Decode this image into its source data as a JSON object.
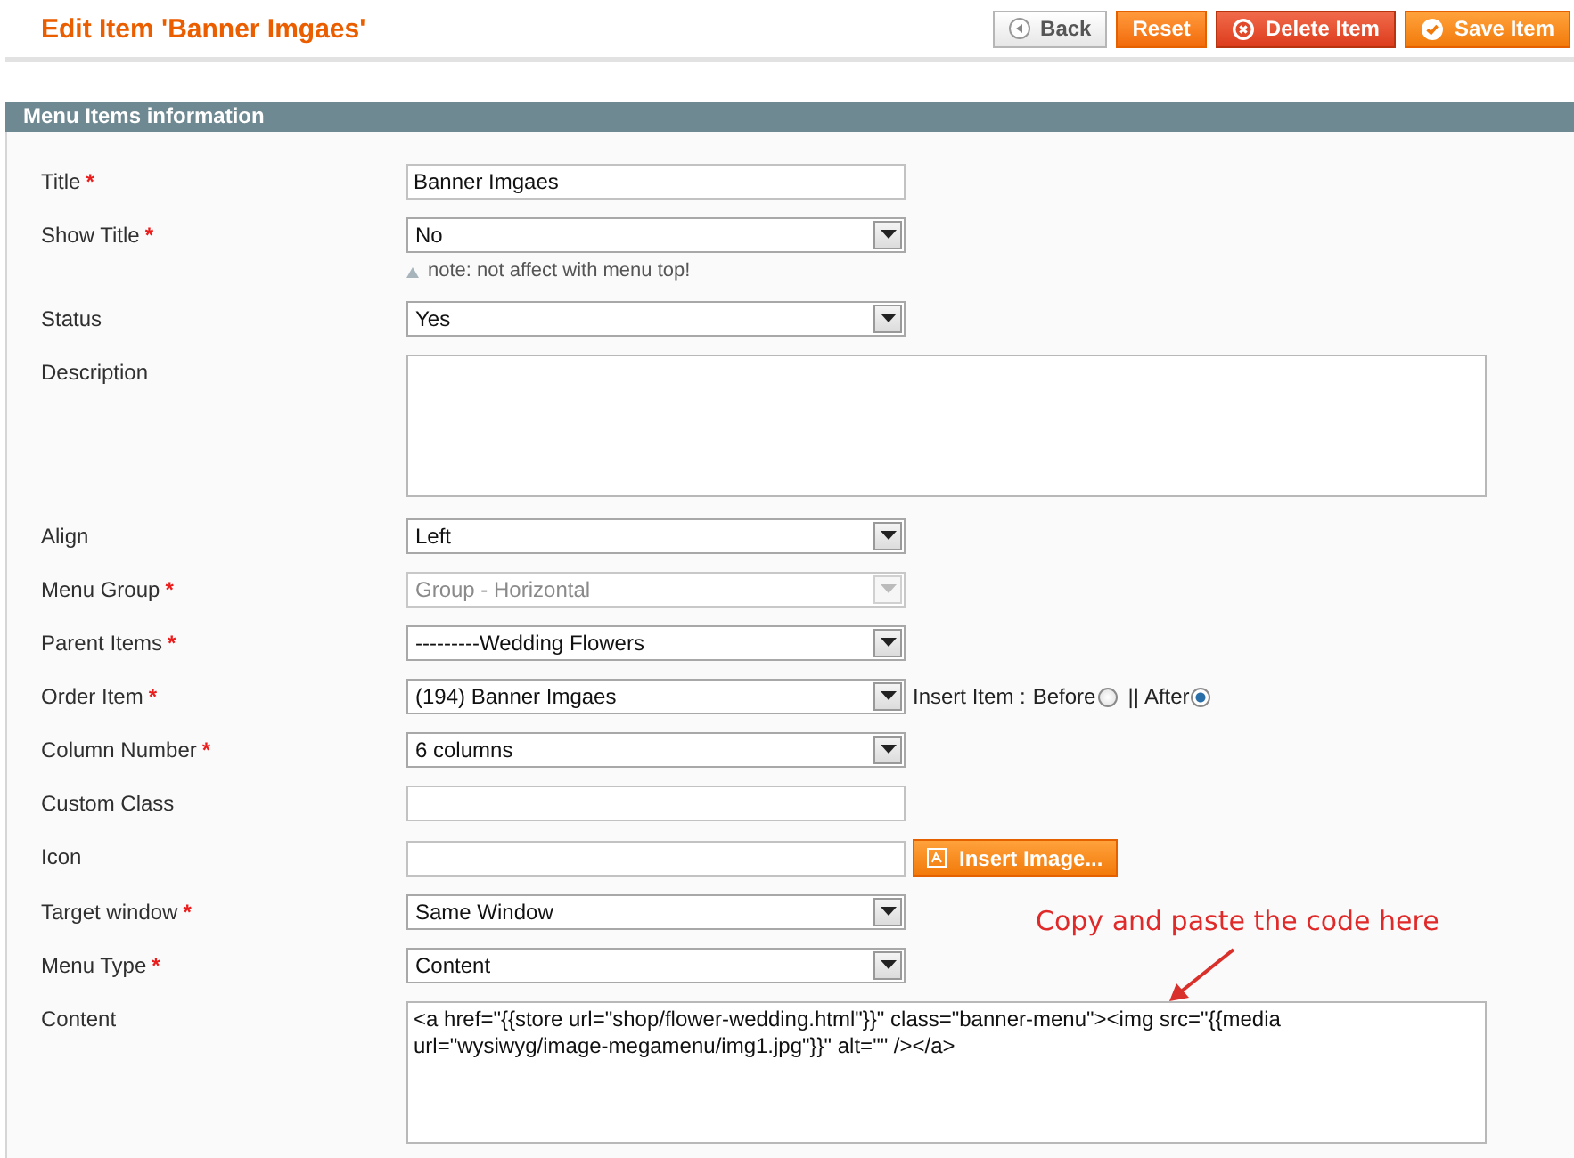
{
  "page": {
    "title": "Edit Item 'Banner Imgaes'"
  },
  "buttons": [
    {
      "label": "Back",
      "kind": "back"
    },
    {
      "label": "Reset",
      "kind": "reset"
    },
    {
      "label": "Delete Item",
      "kind": "delete"
    },
    {
      "label": "Save Item",
      "kind": "save"
    }
  ],
  "section": {
    "title": "Menu Items information"
  },
  "fields": [
    {
      "kind": "text",
      "label": "Title",
      "mark": "*",
      "value": "Banner Imgaes"
    },
    {
      "kind": "select",
      "label": "Show Title",
      "mark": "*",
      "value": "No",
      "disabled": false,
      "note": "note: not affect with menu top!"
    },
    {
      "kind": "select",
      "label": "Status",
      "value": "Yes",
      "disabled": false
    },
    {
      "kind": "textarea",
      "label": "Description"
    },
    {
      "kind": "select",
      "label": "Align",
      "value": "Left",
      "disabled": false
    },
    {
      "kind": "select",
      "label": "Menu Group",
      "mark": "*",
      "value": "Group - Horizontal",
      "disabled": true
    },
    {
      "kind": "select",
      "label": "Parent Items",
      "mark": "*",
      "value": "---------Wedding Flowers",
      "disabled": false
    },
    {
      "kind": "select",
      "label": "Order Item",
      "mark": "*",
      "value": "(194) Banner Imgaes",
      "disabled": false,
      "insert": {
        "label": "Insert Item :",
        "separator": "||",
        "options": [
          {
            "label": "Before",
            "selected": false
          },
          {
            "label": "After",
            "selected": true
          }
        ]
      }
    },
    {
      "kind": "select",
      "label": "Column Number",
      "mark": "*",
      "value": "6 columns",
      "disabled": false
    },
    {
      "kind": "text",
      "label": "Custom Class"
    },
    {
      "kind": "text",
      "label": "Icon",
      "button": "Insert Image..."
    },
    {
      "kind": "select",
      "label": "Target window",
      "mark": "*",
      "value": "Same Window",
      "disabled": false
    },
    {
      "kind": "select",
      "label": "Menu Type",
      "mark": "*",
      "value": "Content",
      "disabled": false
    },
    {
      "kind": "textarea",
      "label": "Content",
      "value": "<a href=\"{{store url=\"shop/flower-wedding.html\"}}\" class=\"banner-menu\"><img src=\"{{media url=\"wysiwyg/image-megamenu/img1.jpg\"}}\" alt=\"\" /></a>"
    }
  ],
  "annotation": {
    "text": "Copy and paste the code here"
  }
}
